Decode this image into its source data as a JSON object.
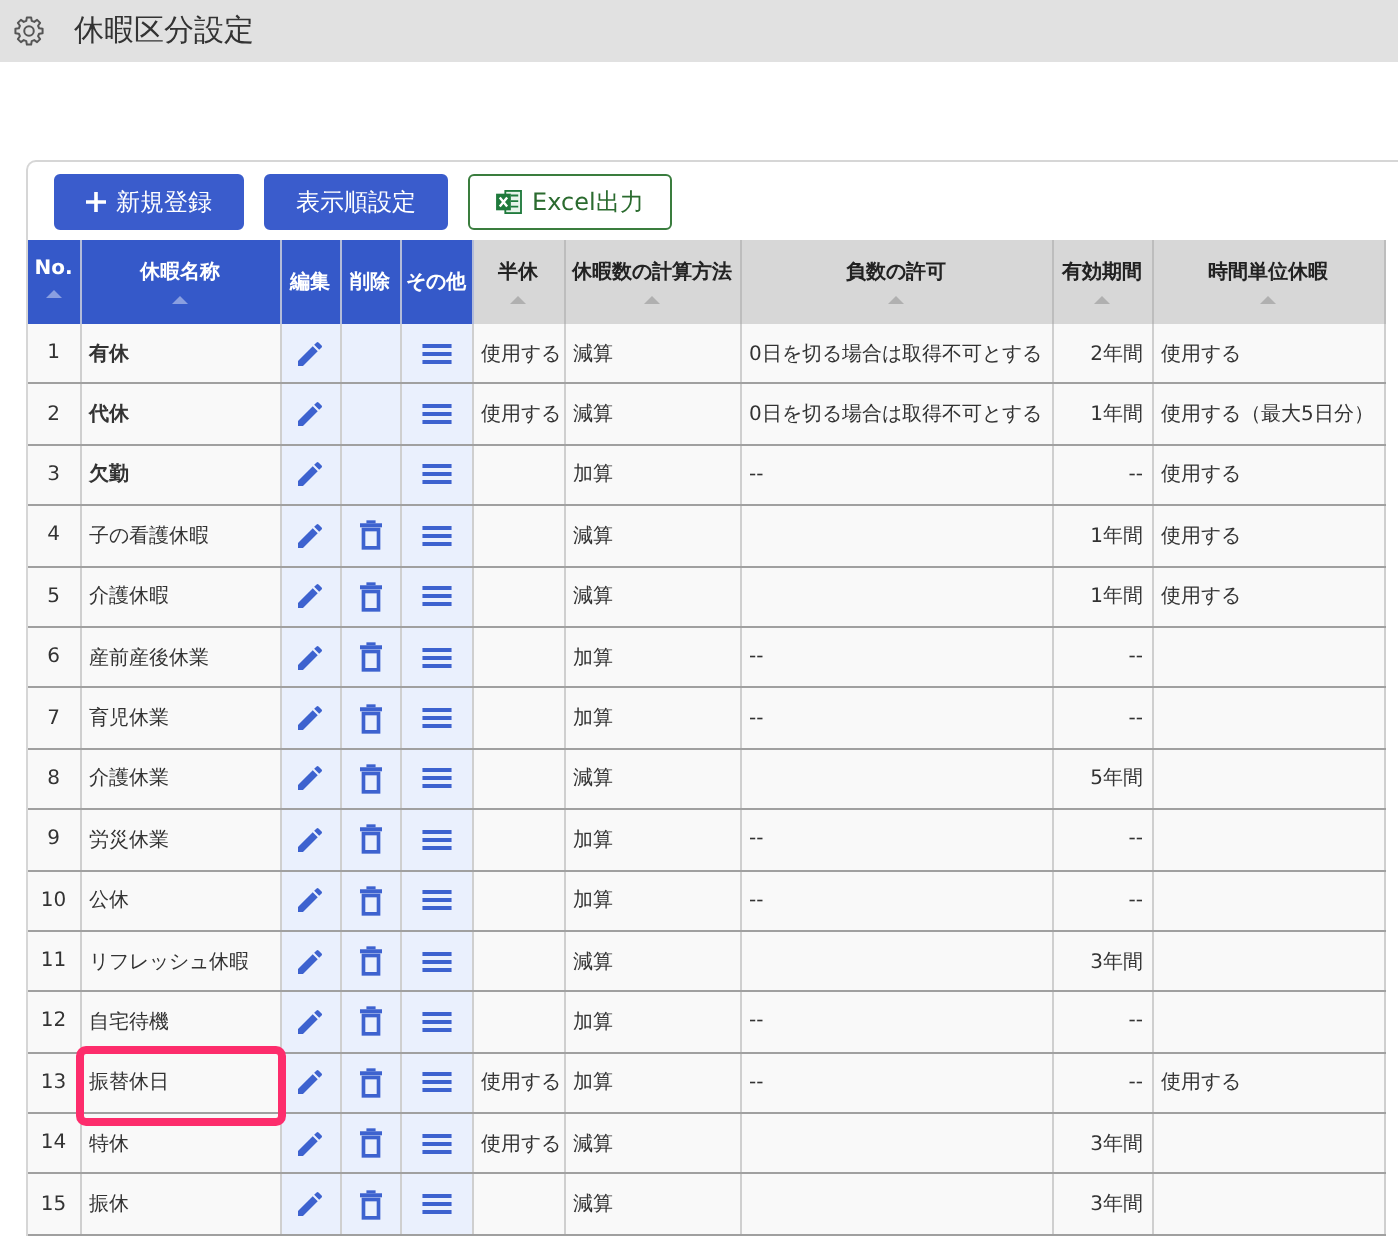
{
  "header": {
    "title": "休暇区分設定"
  },
  "toolbar": {
    "buttons": [
      {
        "kind": "add",
        "label": "新規登録"
      },
      {
        "kind": "primary",
        "label": "表示順設定"
      },
      {
        "kind": "export",
        "label": "Excel出力"
      }
    ]
  },
  "table": {
    "columns": [
      {
        "label": "No.",
        "kind": "key",
        "sortable": true
      },
      {
        "label": "休暇名称",
        "kind": "key",
        "sortable": true
      },
      {
        "label": "編集",
        "kind": "action",
        "sortable": false
      },
      {
        "label": "削除",
        "kind": "action",
        "sortable": false
      },
      {
        "label": "その他",
        "kind": "action",
        "sortable": false
      },
      {
        "label": "半休",
        "kind": "data",
        "sortable": true
      },
      {
        "label": "休暇数の計算方法",
        "kind": "data",
        "sortable": true
      },
      {
        "label": "負数の許可",
        "kind": "data",
        "sortable": true
      },
      {
        "label": "有効期間",
        "kind": "data",
        "sortable": true
      },
      {
        "label": "時間単位休暇",
        "kind": "data",
        "sortable": true
      }
    ],
    "rows": [
      {
        "no": "1",
        "name": "有休",
        "bold": true,
        "deletable": false,
        "highlighted": false,
        "half_day": "使用する",
        "calculation": "減算",
        "negative": "0日を切る場合は取得不可とする",
        "validity": "2年間",
        "hourly": "使用する"
      },
      {
        "no": "2",
        "name": "代休",
        "bold": true,
        "deletable": false,
        "highlighted": false,
        "half_day": "使用する",
        "calculation": "減算",
        "negative": "0日を切る場合は取得不可とする",
        "validity": "1年間",
        "hourly": "使用する（最大5日分）"
      },
      {
        "no": "3",
        "name": "欠勤",
        "bold": true,
        "deletable": false,
        "highlighted": false,
        "calculation": "加算",
        "negative": "--",
        "validity": "--",
        "hourly": "使用する"
      },
      {
        "no": "4",
        "name": "子の看護休暇",
        "bold": false,
        "deletable": true,
        "highlighted": false,
        "calculation": "減算",
        "validity": "1年間",
        "hourly": "使用する"
      },
      {
        "no": "5",
        "name": "介護休暇",
        "bold": false,
        "deletable": true,
        "highlighted": false,
        "calculation": "減算",
        "validity": "1年間",
        "hourly": "使用する"
      },
      {
        "no": "6",
        "name": "産前産後休業",
        "bold": false,
        "deletable": true,
        "highlighted": false,
        "calculation": "加算",
        "negative": "--",
        "validity": "--"
      },
      {
        "no": "7",
        "name": "育児休業",
        "bold": false,
        "deletable": true,
        "highlighted": false,
        "calculation": "加算",
        "negative": "--",
        "validity": "--"
      },
      {
        "no": "8",
        "name": "介護休業",
        "bold": false,
        "deletable": true,
        "highlighted": false,
        "calculation": "減算",
        "validity": "5年間"
      },
      {
        "no": "9",
        "name": "労災休業",
        "bold": false,
        "deletable": true,
        "highlighted": false,
        "calculation": "加算",
        "negative": "--",
        "validity": "--"
      },
      {
        "no": "10",
        "name": "公休",
        "bold": false,
        "deletable": true,
        "highlighted": false,
        "calculation": "加算",
        "negative": "--",
        "validity": "--"
      },
      {
        "no": "11",
        "name": "リフレッシュ休暇",
        "bold": false,
        "deletable": true,
        "highlighted": false,
        "calculation": "減算",
        "validity": "3年間"
      },
      {
        "no": "12",
        "name": "自宅待機",
        "bold": false,
        "deletable": true,
        "highlighted": false,
        "calculation": "加算",
        "negative": "--",
        "validity": "--"
      },
      {
        "no": "13",
        "name": "振替休日",
        "bold": false,
        "deletable": true,
        "highlighted": true,
        "half_day": "使用する",
        "calculation": "加算",
        "negative": "--",
        "validity": "--",
        "hourly": "使用する"
      },
      {
        "no": "14",
        "name": "特休",
        "bold": false,
        "deletable": true,
        "highlighted": false,
        "half_day": "使用する",
        "calculation": "減算",
        "validity": "3年間"
      },
      {
        "no": "15",
        "name": "振休",
        "bold": false,
        "deletable": true,
        "highlighted": false,
        "calculation": "減算",
        "validity": "3年間"
      }
    ]
  }
}
